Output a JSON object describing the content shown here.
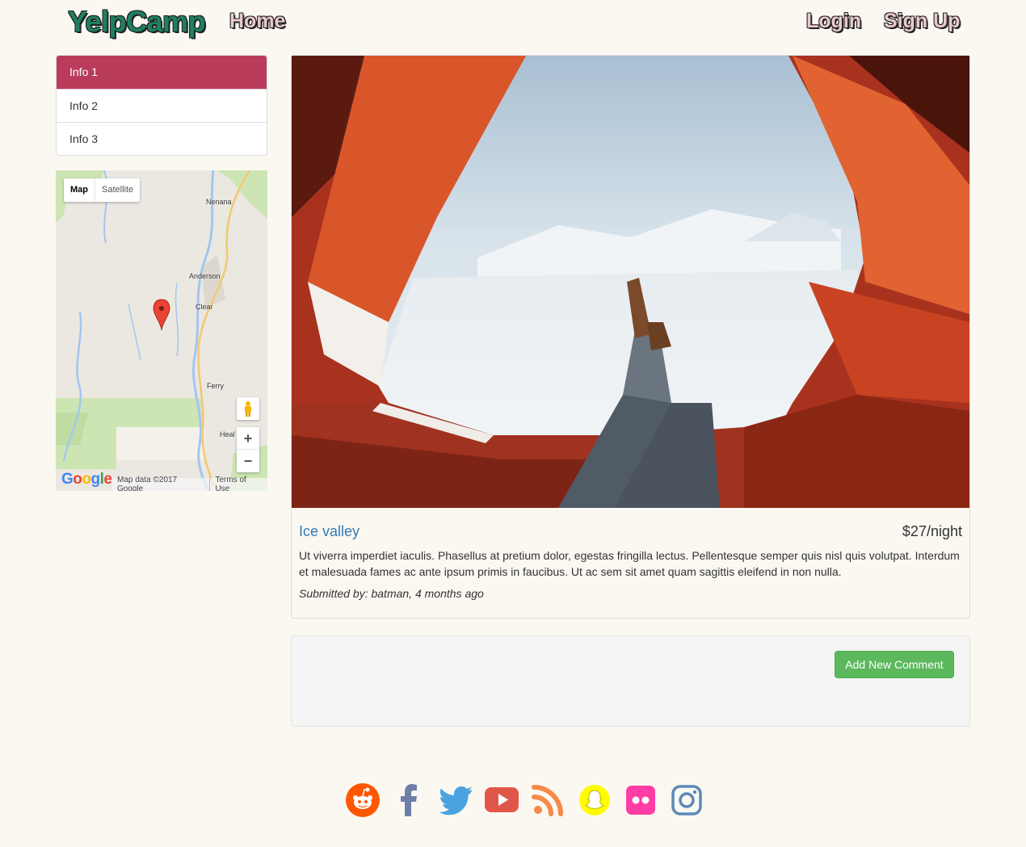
{
  "nav": {
    "brand": "YelpCamp",
    "home": "Home",
    "login": "Login",
    "signup": "Sign Up"
  },
  "sidebar": {
    "items": [
      {
        "label": "Info 1",
        "active": true
      },
      {
        "label": "Info 2",
        "active": false
      },
      {
        "label": "Info 3",
        "active": false
      }
    ]
  },
  "map": {
    "type_map": "Map",
    "type_satellite": "Satellite",
    "places": [
      "Nenana",
      "Anderson",
      "Clear",
      "Ferry",
      "Heal"
    ],
    "google_logo": "Google",
    "attribution": "Map data ©2017 Google",
    "terms": "Terms of Use",
    "zoom_in": "+",
    "zoom_out": "−"
  },
  "campground": {
    "name": "Ice valley",
    "price": "$27/night",
    "description": "Ut viverra imperdiet iaculis. Phasellus at pretium dolor, egestas fringilla lectus. Pellentesque semper quis nisl quis volutpat. Interdum et malesuada fames ac ante ipsum primis in faucibus. Ut ac sem sit amet quam sagittis eleifend in non nulla.",
    "submitted": "Submitted by: batman, 4 months ago"
  },
  "comments": {
    "add_button": "Add New Comment"
  },
  "social": [
    {
      "name": "reddit-icon",
      "color": "#ff5700"
    },
    {
      "name": "facebook-icon",
      "color": "#3b5998"
    },
    {
      "name": "twitter-icon",
      "color": "#1da1f2"
    },
    {
      "name": "youtube-icon",
      "color": "#e52d27"
    },
    {
      "name": "rss-icon",
      "color": "#f26522"
    },
    {
      "name": "snapchat-icon",
      "color": "#fffc00"
    },
    {
      "name": "flickr-icon",
      "color": "#ff0084"
    },
    {
      "name": "instagram-icon",
      "color": "#3f729b"
    }
  ]
}
